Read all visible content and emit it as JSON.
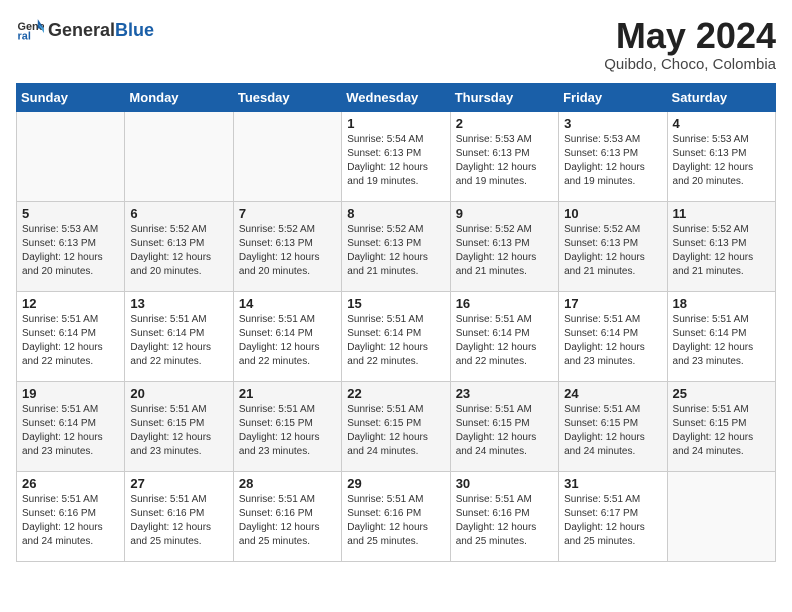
{
  "header": {
    "logo_general": "General",
    "logo_blue": "Blue",
    "month_title": "May 2024",
    "location": "Quibdo, Choco, Colombia"
  },
  "days_of_week": [
    "Sunday",
    "Monday",
    "Tuesday",
    "Wednesday",
    "Thursday",
    "Friday",
    "Saturday"
  ],
  "weeks": [
    [
      {
        "day": "",
        "info": ""
      },
      {
        "day": "",
        "info": ""
      },
      {
        "day": "",
        "info": ""
      },
      {
        "day": "1",
        "info": "Sunrise: 5:54 AM\nSunset: 6:13 PM\nDaylight: 12 hours\nand 19 minutes."
      },
      {
        "day": "2",
        "info": "Sunrise: 5:53 AM\nSunset: 6:13 PM\nDaylight: 12 hours\nand 19 minutes."
      },
      {
        "day": "3",
        "info": "Sunrise: 5:53 AM\nSunset: 6:13 PM\nDaylight: 12 hours\nand 19 minutes."
      },
      {
        "day": "4",
        "info": "Sunrise: 5:53 AM\nSunset: 6:13 PM\nDaylight: 12 hours\nand 20 minutes."
      }
    ],
    [
      {
        "day": "5",
        "info": "Sunrise: 5:53 AM\nSunset: 6:13 PM\nDaylight: 12 hours\nand 20 minutes."
      },
      {
        "day": "6",
        "info": "Sunrise: 5:52 AM\nSunset: 6:13 PM\nDaylight: 12 hours\nand 20 minutes."
      },
      {
        "day": "7",
        "info": "Sunrise: 5:52 AM\nSunset: 6:13 PM\nDaylight: 12 hours\nand 20 minutes."
      },
      {
        "day": "8",
        "info": "Sunrise: 5:52 AM\nSunset: 6:13 PM\nDaylight: 12 hours\nand 21 minutes."
      },
      {
        "day": "9",
        "info": "Sunrise: 5:52 AM\nSunset: 6:13 PM\nDaylight: 12 hours\nand 21 minutes."
      },
      {
        "day": "10",
        "info": "Sunrise: 5:52 AM\nSunset: 6:13 PM\nDaylight: 12 hours\nand 21 minutes."
      },
      {
        "day": "11",
        "info": "Sunrise: 5:52 AM\nSunset: 6:13 PM\nDaylight: 12 hours\nand 21 minutes."
      }
    ],
    [
      {
        "day": "12",
        "info": "Sunrise: 5:51 AM\nSunset: 6:14 PM\nDaylight: 12 hours\nand 22 minutes."
      },
      {
        "day": "13",
        "info": "Sunrise: 5:51 AM\nSunset: 6:14 PM\nDaylight: 12 hours\nand 22 minutes."
      },
      {
        "day": "14",
        "info": "Sunrise: 5:51 AM\nSunset: 6:14 PM\nDaylight: 12 hours\nand 22 minutes."
      },
      {
        "day": "15",
        "info": "Sunrise: 5:51 AM\nSunset: 6:14 PM\nDaylight: 12 hours\nand 22 minutes."
      },
      {
        "day": "16",
        "info": "Sunrise: 5:51 AM\nSunset: 6:14 PM\nDaylight: 12 hours\nand 22 minutes."
      },
      {
        "day": "17",
        "info": "Sunrise: 5:51 AM\nSunset: 6:14 PM\nDaylight: 12 hours\nand 23 minutes."
      },
      {
        "day": "18",
        "info": "Sunrise: 5:51 AM\nSunset: 6:14 PM\nDaylight: 12 hours\nand 23 minutes."
      }
    ],
    [
      {
        "day": "19",
        "info": "Sunrise: 5:51 AM\nSunset: 6:14 PM\nDaylight: 12 hours\nand 23 minutes."
      },
      {
        "day": "20",
        "info": "Sunrise: 5:51 AM\nSunset: 6:15 PM\nDaylight: 12 hours\nand 23 minutes."
      },
      {
        "day": "21",
        "info": "Sunrise: 5:51 AM\nSunset: 6:15 PM\nDaylight: 12 hours\nand 23 minutes."
      },
      {
        "day": "22",
        "info": "Sunrise: 5:51 AM\nSunset: 6:15 PM\nDaylight: 12 hours\nand 24 minutes."
      },
      {
        "day": "23",
        "info": "Sunrise: 5:51 AM\nSunset: 6:15 PM\nDaylight: 12 hours\nand 24 minutes."
      },
      {
        "day": "24",
        "info": "Sunrise: 5:51 AM\nSunset: 6:15 PM\nDaylight: 12 hours\nand 24 minutes."
      },
      {
        "day": "25",
        "info": "Sunrise: 5:51 AM\nSunset: 6:15 PM\nDaylight: 12 hours\nand 24 minutes."
      }
    ],
    [
      {
        "day": "26",
        "info": "Sunrise: 5:51 AM\nSunset: 6:16 PM\nDaylight: 12 hours\nand 24 minutes."
      },
      {
        "day": "27",
        "info": "Sunrise: 5:51 AM\nSunset: 6:16 PM\nDaylight: 12 hours\nand 25 minutes."
      },
      {
        "day": "28",
        "info": "Sunrise: 5:51 AM\nSunset: 6:16 PM\nDaylight: 12 hours\nand 25 minutes."
      },
      {
        "day": "29",
        "info": "Sunrise: 5:51 AM\nSunset: 6:16 PM\nDaylight: 12 hours\nand 25 minutes."
      },
      {
        "day": "30",
        "info": "Sunrise: 5:51 AM\nSunset: 6:16 PM\nDaylight: 12 hours\nand 25 minutes."
      },
      {
        "day": "31",
        "info": "Sunrise: 5:51 AM\nSunset: 6:17 PM\nDaylight: 12 hours\nand 25 minutes."
      },
      {
        "day": "",
        "info": ""
      }
    ]
  ]
}
